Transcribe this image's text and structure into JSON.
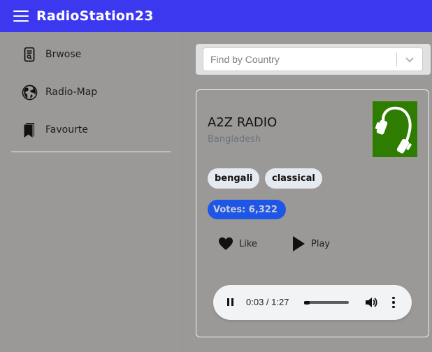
{
  "app": {
    "title": "RadioStation23",
    "brand_color": "#3b38f0"
  },
  "sidebar": {
    "items": [
      {
        "label": "Brwose",
        "icon": "browse-document-search-icon"
      },
      {
        "label": "Radio-Map",
        "icon": "globe-icon"
      },
      {
        "label": "Favourte",
        "icon": "bookmarks-icon"
      }
    ]
  },
  "filter": {
    "placeholder": "Find by Country",
    "value": ""
  },
  "station": {
    "name": "A2Z RADIO",
    "country": "Bangladesh",
    "logo_icon": "headphones-icon",
    "logo_bg": "#2e7d00",
    "tags": [
      "bengali",
      "classical"
    ],
    "votes_label": "Votes: 6,322",
    "votes_color": "#1e56e8",
    "actions": {
      "like_label": "Like",
      "play_label": "Play"
    }
  },
  "player": {
    "state": "playing",
    "time_display": "0:03 / 1:27",
    "progress_fraction": 0.034
  }
}
